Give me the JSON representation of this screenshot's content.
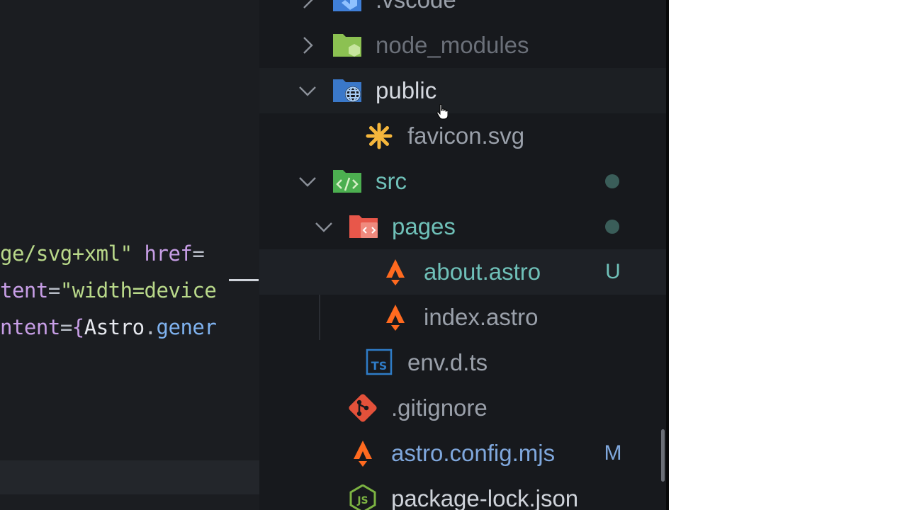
{
  "editor": {
    "lines": [
      {
        "segments": [
          {
            "cls": "c-str",
            "text": "ge/svg+xml\""
          },
          {
            "cls": "c-punc",
            "text": " "
          },
          {
            "cls": "c-attr",
            "text": "href"
          },
          {
            "cls": "c-punc",
            "text": "="
          }
        ]
      },
      {
        "segments": [
          {
            "cls": "c-attr",
            "text": "tent"
          },
          {
            "cls": "c-punc",
            "text": "="
          },
          {
            "cls": "c-str",
            "text": "\"width=device"
          }
        ]
      },
      {
        "segments": [
          {
            "cls": "c-attr",
            "text": "ntent"
          },
          {
            "cls": "c-punc",
            "text": "="
          },
          {
            "cls": "c-brace",
            "text": "{"
          },
          {
            "cls": "c-ident",
            "text": "Astro"
          },
          {
            "cls": "c-punc",
            "text": "."
          },
          {
            "cls": "c-prop",
            "text": "gener"
          }
        ]
      }
    ]
  },
  "explorer": {
    "items": [
      {
        "name": ".vscode",
        "type": "folder",
        "expanded": false,
        "icon": "vscode-folder-icon",
        "color": "#9aa0aa",
        "badge": ""
      },
      {
        "name": "node_modules",
        "type": "folder",
        "expanded": false,
        "icon": "node-folder-icon",
        "color": "#6b7079",
        "badge": ""
      },
      {
        "name": "public",
        "type": "folder",
        "expanded": true,
        "icon": "public-folder-icon",
        "color": "#d5d9e0",
        "badge": ""
      },
      {
        "name": "favicon.svg",
        "type": "file",
        "icon": "svg-file-icon",
        "color": "#9aa0aa",
        "badge": ""
      },
      {
        "name": "src",
        "type": "folder",
        "expanded": true,
        "icon": "src-folder-icon",
        "color": "#6fc0b8",
        "badge": "dot"
      },
      {
        "name": "pages",
        "type": "folder",
        "expanded": true,
        "icon": "pages-folder-icon",
        "color": "#6fc0b8",
        "badge": "dot"
      },
      {
        "name": "about.astro",
        "type": "file",
        "icon": "astro-file-icon",
        "color": "#6fc0b8",
        "badge": "U"
      },
      {
        "name": "index.astro",
        "type": "file",
        "icon": "astro-file-icon",
        "color": "#9aa0aa",
        "badge": ""
      },
      {
        "name": "env.d.ts",
        "type": "file",
        "icon": "typescript-file-icon",
        "color": "#9aa0aa",
        "badge": ""
      },
      {
        "name": ".gitignore",
        "type": "file",
        "icon": "git-file-icon",
        "color": "#9aa0aa",
        "badge": ""
      },
      {
        "name": "astro.config.mjs",
        "type": "file",
        "icon": "astro-file-icon",
        "color": "#7fa7dc",
        "badge": "M"
      },
      {
        "name": "package-lock.json",
        "type": "file",
        "icon": "nodejs-file-icon",
        "color": "#cfd3da",
        "badge": ""
      }
    ],
    "badge_colors": {
      "U": "#6fc0b8",
      "M": "#7fa7dc",
      "dot": "#3a5d59"
    }
  }
}
